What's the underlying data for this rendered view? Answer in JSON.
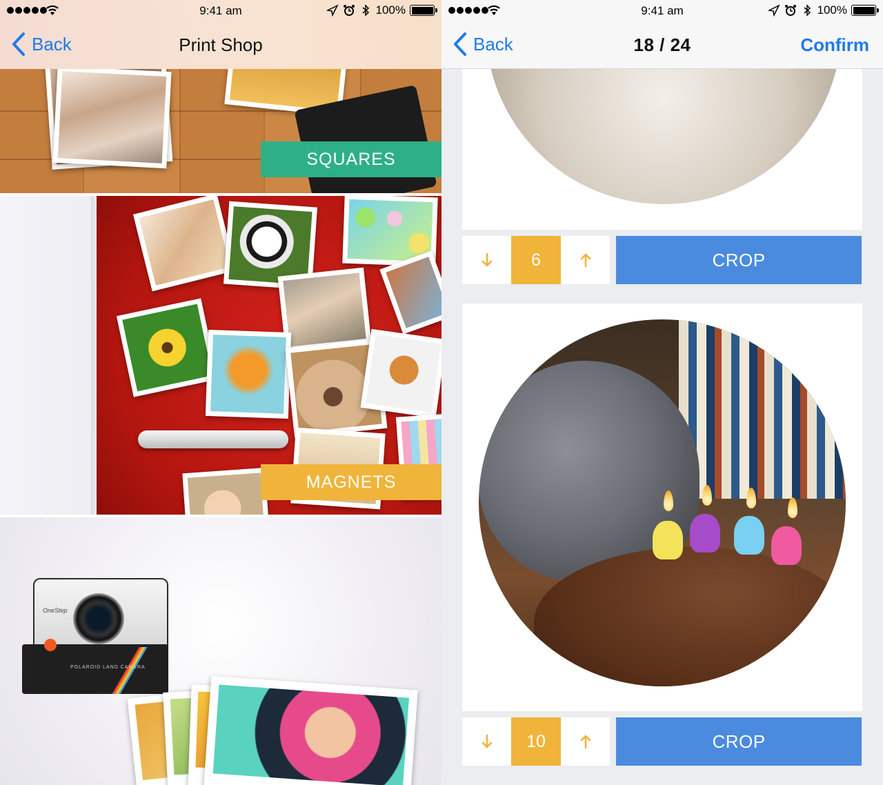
{
  "status_bar": {
    "time": "9:41 am",
    "battery": "100%"
  },
  "left_screen": {
    "nav": {
      "back_label": "Back",
      "title": "Print Shop"
    },
    "products": [
      {
        "label": "SQUARES",
        "color": "#2eb087"
      },
      {
        "label": "MAGNETS",
        "color": "#f0b43a"
      },
      {
        "label": "",
        "color": ""
      }
    ],
    "camera_brand": "OneStep",
    "camera_text": "POLAROID LAND CAMERA"
  },
  "right_screen": {
    "nav": {
      "back_label": "Back",
      "title": "18 / 24",
      "confirm_label": "Confirm"
    },
    "prints": [
      {
        "quantity": "6",
        "crop_label": "CROP"
      },
      {
        "quantity": "10",
        "crop_label": "CROP"
      }
    ]
  },
  "colors": {
    "accent_blue": "#1f7aea",
    "crop_blue": "#4a8bdf",
    "quantity_yellow": "#f0b43a",
    "squares_green": "#2eb087"
  },
  "icons": [
    "signal-icon",
    "wifi-icon",
    "location-icon",
    "alarm-icon",
    "bluetooth-icon",
    "battery-icon",
    "chevron-left-icon",
    "arrow-down-icon",
    "arrow-up-icon"
  ]
}
